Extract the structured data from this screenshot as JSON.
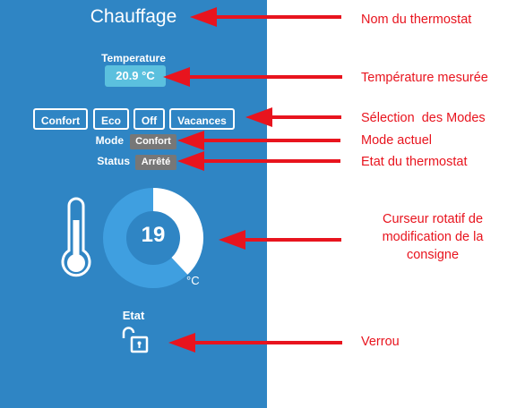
{
  "thermostat": {
    "title": "Chauffage",
    "temperature_label": "Temperature",
    "temperature_value": "20.9 °C",
    "modes": [
      "Confort",
      "Eco",
      "Off",
      "Vacances"
    ],
    "mode_label": "Mode",
    "mode_value": "Confort",
    "status_label": "Status",
    "status_value": "Arrêté",
    "setpoint": {
      "value": "19",
      "unit": "°C",
      "fraction": 0.38
    },
    "lock_label": "Etat",
    "lock_state": "unlocked"
  },
  "annotations": [
    "Nom du thermostat",
    "Température mesurée",
    "Sélection  des Modes",
    "Mode actuel",
    "Etat du thermostat",
    "Curseur rotatif de modification de la consigne",
    "Verrou"
  ],
  "icons": {
    "thermometer": "thermometer-icon",
    "lock": "unlocked-padlock-icon"
  },
  "colors": {
    "panel": "#2f85c4",
    "temperature_box": "#5bc0de",
    "badge": "#777777",
    "dial_track": "#3f9fe0",
    "dial_progress": "#ffffff",
    "annotation": "#e8141e"
  }
}
